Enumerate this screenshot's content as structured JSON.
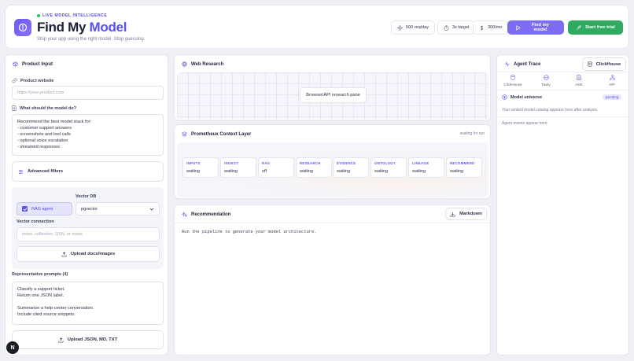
{
  "header": {
    "eyebrow": "LIVE MODEL INTELLIGENCE",
    "title_part1": "Find My ",
    "title_part2": "Model",
    "tagline": "Ship your app using the right model. Stop guessing.",
    "stats": [
      {
        "icon": "sparkle-icon",
        "label": "500 req/day"
      },
      {
        "icon": "timer-icon",
        "label": "3s target"
      },
      {
        "icon": "dollar-icon",
        "label": "300/mo"
      }
    ],
    "find_button": "Find my model",
    "trial_button": "Start free trial",
    "colors": {
      "primary": "#6b5cf0",
      "trial": "#22a85a",
      "accent": "#5b54e8"
    }
  },
  "product_input": {
    "title": "Product Input",
    "website_label": "Product website",
    "website_placeholder": "https://your-product.com",
    "task_label": "What should the model do?",
    "task_text": "Recommend the best model stack for:\n- customer support answers\n- screenshots and tool calls\n- optional voice escalation\n- streamed responses",
    "advanced_filters": "Advanced filters",
    "vector_db_label": "Vector DB",
    "rag_agent_label": "RAG agent",
    "rag_checked": true,
    "vector_db_value": "pgvector",
    "vector_connection_label": "Vector connection",
    "vector_connection_placeholder": "index, collection, DSN, or notes",
    "upload_docs": "Upload docs/images",
    "prompts_label": "Representative prompts (4)",
    "prompts_text": "Classify a support ticket.\nReturn one JSON label.\n\nSummarize a help-center conversation.\nInclude cited source snippets.",
    "upload_json": "Upload JSON, MD, TXT"
  },
  "web_research": {
    "title": "Web Research",
    "pane_label": "Browser/API research pane"
  },
  "prometheus": {
    "title": "Prometheux Context Layer",
    "status": "waiting for run",
    "stages": [
      {
        "name": "INPUTS",
        "value": "waiting"
      },
      {
        "name": "INGEST",
        "value": "waiting"
      },
      {
        "name": "RAG",
        "value": "off"
      },
      {
        "name": "RESEARCH",
        "value": "waiting"
      },
      {
        "name": "EVIDENCE",
        "value": "waiting"
      },
      {
        "name": "ONTOLOGY",
        "value": "waiting"
      },
      {
        "name": "LINEAGE",
        "value": "waiting"
      },
      {
        "name": "RECOMMEND",
        "value": "waiting"
      }
    ]
  },
  "recommendation": {
    "title": "Recommendation",
    "markdown_button": "Markdown",
    "placeholder": "Run the pipeline to generate your model architecture."
  },
  "agent_trace": {
    "title": "Agent Trace",
    "clickhouse_button": "ClickHouse",
    "tabs": [
      {
        "icon": "database-icon",
        "label": "ClickHouse"
      },
      {
        "icon": "globe-icon",
        "label": "Tavily"
      },
      {
        "icon": "document-icon",
        "label": "ADK"
      },
      {
        "icon": "network-icon",
        "label": "API"
      }
    ],
    "model_universe": "Model universe",
    "pending_badge": "pending",
    "catalog_note": "Your ranked model catalog appears here after analysis.",
    "events_note": "Agent events appear here."
  },
  "footer": {
    "avatar_letter": "N"
  }
}
